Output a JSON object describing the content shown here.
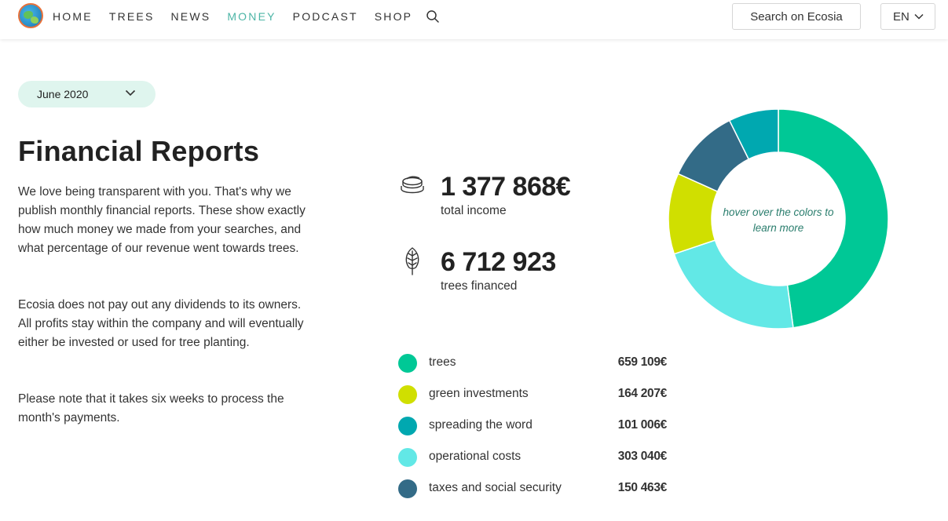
{
  "nav": {
    "items": [
      "HOME",
      "TREES",
      "NEWS",
      "MONEY",
      "PODCAST",
      "SHOP"
    ],
    "active": "MONEY",
    "search_button": "Search on Ecosia",
    "language": "EN"
  },
  "report": {
    "month": "June 2020",
    "title": "Financial Reports",
    "paragraphs": [
      "We love being transparent with you. That's why we publish monthly financial reports. These show exactly how much money we made from your searches, and what percentage of our revenue went towards trees.",
      "Ecosia does not pay out any dividends to its owners. All profits stay within the company and will eventually either be invested or used for tree planting.",
      "Please note that it takes six weeks to process the month's payments."
    ]
  },
  "stats": {
    "income_value": "1 377 868€",
    "income_label": "total income",
    "income_icon": "coins-icon",
    "trees_value": "6 712 923",
    "trees_label": "trees financed",
    "trees_icon": "leaf-icon"
  },
  "breakdown": [
    {
      "label": "trees",
      "amount": "659 109€",
      "value": 659109,
      "color": "#00c896"
    },
    {
      "label": "green investments",
      "amount": "164 207€",
      "value": 164207,
      "color": "#d0df00"
    },
    {
      "label": "spreading the word",
      "amount": "101 006€",
      "value": 101006,
      "color": "#00a8b0"
    },
    {
      "label": "operational costs",
      "amount": "303 040€",
      "value": 303040,
      "color": "#62e8e6"
    },
    {
      "label": "taxes and social security",
      "amount": "150 463€",
      "value": 150463,
      "color": "#336b87"
    }
  ],
  "donut": {
    "hint": "hover over the colors to learn more",
    "order": [
      0,
      3,
      1,
      4,
      2
    ]
  }
}
